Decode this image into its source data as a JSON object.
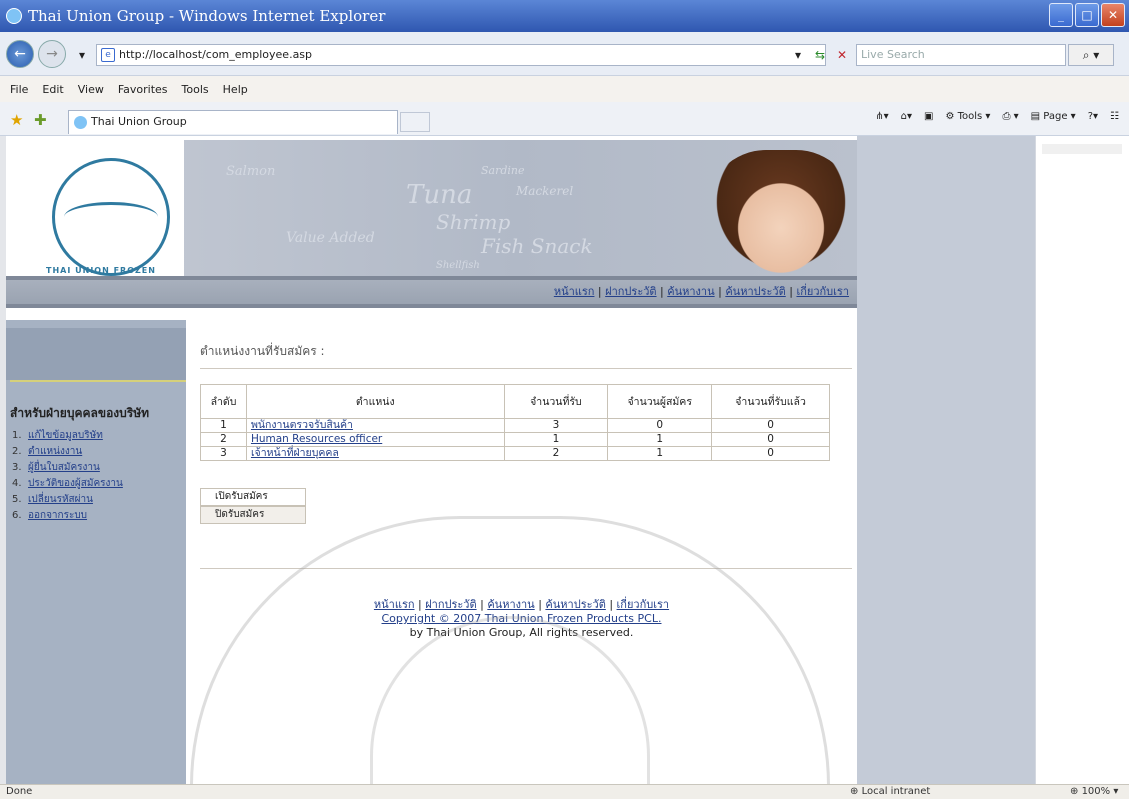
{
  "window": {
    "title": "Thai Union Group - Windows Internet Explorer"
  },
  "address": {
    "url": "http://localhost/com_employee.asp",
    "search_placeholder": "Live Search"
  },
  "menu": [
    "File",
    "Edit",
    "View",
    "Favorites",
    "Tools",
    "Help"
  ],
  "tab": {
    "label": "Thai Union Group"
  },
  "command_bar": {
    "tools": "Tools",
    "page": "Page"
  },
  "banner": {
    "logo_text": "THAI UNION FROZEN PRODUCTS PCL.",
    "words": [
      "Salmon",
      "Sardine",
      "Tuna",
      "Mackerel",
      "Shrimp",
      "Value Added",
      "Fish Snack",
      "Shellfish"
    ]
  },
  "top_nav": [
    "หน้าแรก",
    "ฝากประวัติ",
    "ค้นหางาน",
    "ค้นหาประวัติ",
    "เกี่ยวกับเรา"
  ],
  "sidebar": {
    "title": "สำหรับฝ่ายบุคคลของบริษัท",
    "items": [
      {
        "num": "1.",
        "label": "แก้ไขข้อมูลบริษัท"
      },
      {
        "num": "2.",
        "label": "ตำแหน่งงาน"
      },
      {
        "num": "3.",
        "label": "ผู้ยื่นใบสมัครงาน"
      },
      {
        "num": "4.",
        "label": "ประวัติของผู้สมัครงาน"
      },
      {
        "num": "5.",
        "label": "เปลี่ยนรหัสผ่าน"
      },
      {
        "num": "6.",
        "label": "ออกจากระบบ"
      }
    ]
  },
  "main": {
    "title": "ตำแหน่งงานที่รับสมัคร :",
    "table": {
      "headers": [
        "ลำดับ",
        "ตำแหน่ง",
        "จำนวนที่รับ",
        "จำนวนผู้สมัคร",
        "จำนวนที่รับแล้ว"
      ],
      "rows": [
        [
          "1",
          "พนักงานตรวจรับสินค้า",
          "3",
          "0",
          "0"
        ],
        [
          "2",
          "Human Resources officer",
          "1",
          "1",
          "0"
        ],
        [
          "3",
          "เจ้าหน้าที่ฝ่ายบุคคล",
          "2",
          "1",
          "0"
        ]
      ]
    },
    "buttons": {
      "open": "เปิดรับสมัคร",
      "close": "ปิดรับสมัคร"
    }
  },
  "footer": {
    "links": [
      "หน้าแรก",
      "ฝากประวัติ",
      "ค้นหางาน",
      "ค้นหาประวัติ",
      "เกี่ยวกับเรา"
    ],
    "copyright": "Copyright © 2007 Thai Union Frozen Products PCL.",
    "rights": "by Thai Union Group, All rights reserved."
  },
  "status": {
    "left": "Done",
    "zone": "Local intranet",
    "zoom": "100%"
  }
}
